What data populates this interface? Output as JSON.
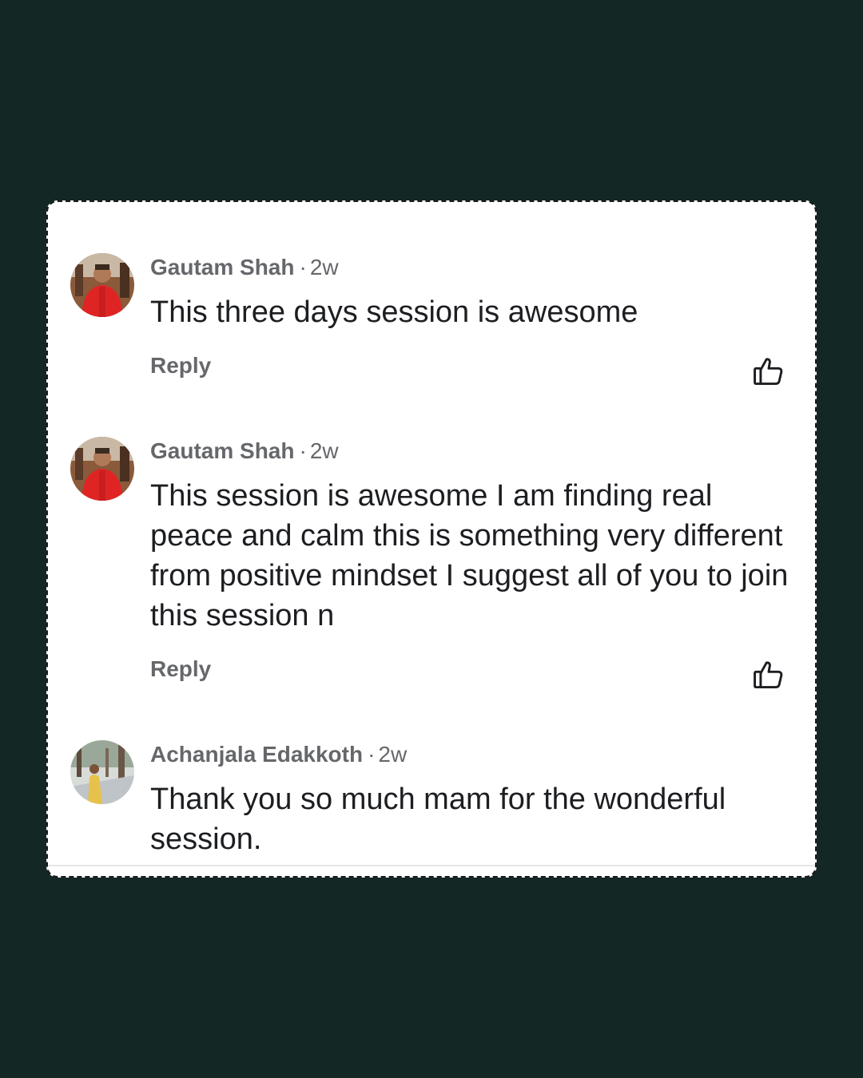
{
  "comments": [
    {
      "author": "Gautam Shah",
      "separator": "·",
      "time": "2w",
      "text": "This three days session is awesome",
      "reply_label": "Reply",
      "avatar_icon": "person-red-jacket-avatar",
      "like_icon": "thumbs-up-icon"
    },
    {
      "author": "Gautam Shah",
      "separator": "·",
      "time": "2w",
      "text": "This session is awesome I am finding real peace and calm this is something very different from positive mindset I suggest all of you to join this session n",
      "reply_label": "Reply",
      "avatar_icon": "person-red-jacket-avatar",
      "like_icon": "thumbs-up-icon"
    },
    {
      "author": "Achanjala Edakkoth",
      "separator": "·",
      "time": "2w",
      "text": "Thank you so much mam for the wonderful session.",
      "avatar_icon": "person-outdoor-avatar"
    }
  ],
  "colors": {
    "background": "#132824",
    "card": "#ffffff",
    "meta_text": "#65676b",
    "body_text": "#1c1e21"
  }
}
